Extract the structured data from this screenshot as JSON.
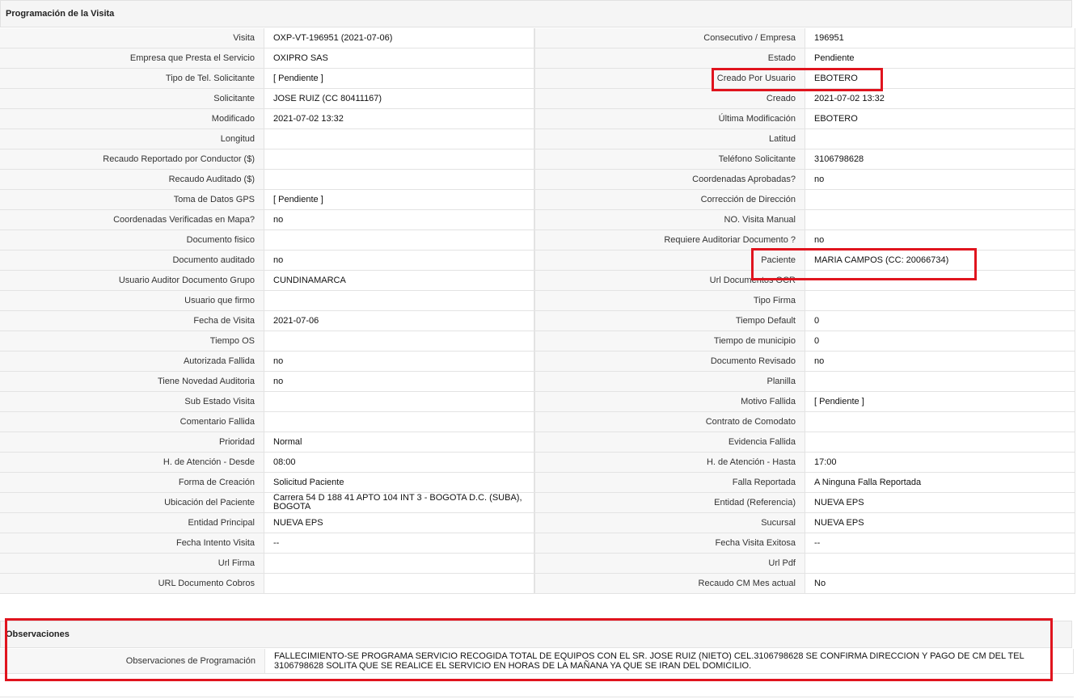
{
  "section_title": "Programación de la Visita",
  "rows": [
    [
      {
        "label": "Visita",
        "value": "OXP-VT-196951 (2021-07-06)"
      },
      {
        "label": "Consecutivo / Empresa",
        "value": "196951"
      }
    ],
    [
      {
        "label": "Empresa que Presta el Servicio",
        "value": "OXIPRO SAS"
      },
      {
        "label": "Estado",
        "value": "Pendiente"
      }
    ],
    [
      {
        "label": "Tipo de Tel. Solicitante",
        "value": "[ Pendiente ]"
      },
      {
        "label": "Creado Por Usuario",
        "value": "EBOTERO"
      }
    ],
    [
      {
        "label": "Solicitante",
        "value": "JOSE RUIZ (CC 80411167)"
      },
      {
        "label": "Creado",
        "value": "2021-07-02 13:32"
      }
    ],
    [
      {
        "label": "Modificado",
        "value": "2021-07-02 13:32"
      },
      {
        "label": "Última Modificación",
        "value": " EBOTERO"
      }
    ],
    [
      {
        "label": "Longitud",
        "value": ""
      },
      {
        "label": "Latitud",
        "value": ""
      }
    ],
    [
      {
        "label": "Recaudo Reportado por Conductor ($)",
        "value": ""
      },
      {
        "label": "Teléfono Solicitante",
        "value": "3106798628"
      }
    ],
    [
      {
        "label": "Recaudo Auditado ($)",
        "value": ""
      },
      {
        "label": "Coordenadas Aprobadas?",
        "value": " no"
      }
    ],
    [
      {
        "label": "Toma de Datos GPS",
        "value": "[ Pendiente ]"
      },
      {
        "label": "Corrección de Dirección",
        "value": ""
      }
    ],
    [
      {
        "label": "Coordenadas Verificadas en Mapa?",
        "value": " no"
      },
      {
        "label": "NO. Visita Manual",
        "value": ""
      }
    ],
    [
      {
        "label": "Documento fisico",
        "value": ""
      },
      {
        "label": "Requiere Auditoriar Documento ?",
        "value": " no"
      }
    ],
    [
      {
        "label": "Documento auditado",
        "value": " no"
      },
      {
        "label": "Paciente",
        "value": "MARIA CAMPOS (CC: 20066734)"
      }
    ],
    [
      {
        "label": "Usuario Auditor Documento Grupo",
        "value": "CUNDINAMARCA"
      },
      {
        "label": "Url Documentos OCR",
        "value": ""
      }
    ],
    [
      {
        "label": "Usuario que firmo",
        "value": ""
      },
      {
        "label": "Tipo Firma",
        "value": ""
      }
    ],
    [
      {
        "label": "Fecha de Visita",
        "value": " 2021-07-06"
      },
      {
        "label": "Tiempo Default",
        "value": "0"
      }
    ],
    [
      {
        "label": "Tiempo OS",
        "value": ""
      },
      {
        "label": "Tiempo de municipio",
        "value": "0"
      }
    ],
    [
      {
        "label": "Autorizada Fallida",
        "value": " no"
      },
      {
        "label": "Documento Revisado",
        "value": " no"
      }
    ],
    [
      {
        "label": "Tiene Novedad Auditoria",
        "value": " no"
      },
      {
        "label": "Planilla",
        "value": ""
      }
    ],
    [
      {
        "label": "Sub Estado Visita",
        "value": ""
      },
      {
        "label": "Motivo Fallida",
        "value": "[ Pendiente ]"
      }
    ],
    [
      {
        "label": "Comentario Fallida",
        "value": ""
      },
      {
        "label": "Contrato de Comodato",
        "value": ""
      }
    ],
    [
      {
        "label": "Prioridad",
        "value": "Normal"
      },
      {
        "label": "Evidencia Fallida",
        "value": ""
      }
    ],
    [
      {
        "label": "H. de Atención - Desde",
        "value": "08:00"
      },
      {
        "label": "H. de Atención - Hasta",
        "value": "17:00"
      }
    ],
    [
      {
        "label": "Forma de Creación",
        "value": "Solicitud Paciente"
      },
      {
        "label": "Falla Reportada",
        "value": "A Ninguna Falla Reportada"
      }
    ],
    [
      {
        "label": "Ubicación del Paciente",
        "value": "Carrera 54 D 188 41 APTO 104 INT 3 - BOGOTA D.C. (SUBA), BOGOTA"
      },
      {
        "label": "Entidad (Referencia)",
        "value": "NUEVA EPS"
      }
    ],
    [
      {
        "label": "Entidad Principal",
        "value": "NUEVA EPS"
      },
      {
        "label": "Sucursal",
        "value": "NUEVA EPS"
      }
    ],
    [
      {
        "label": "Fecha Intento Visita",
        "value": " --"
      },
      {
        "label": "Fecha Visita Exitosa",
        "value": " --"
      }
    ],
    [
      {
        "label": "Url Firma",
        "value": ""
      },
      {
        "label": "Url Pdf",
        "value": ""
      }
    ],
    [
      {
        "label": "URL Documento Cobros",
        "value": ""
      },
      {
        "label": "Recaudo CM Mes actual",
        "value": "No"
      }
    ]
  ],
  "observations": {
    "title": "Observaciones",
    "label": "Observaciones de Programación",
    "value": "  FALLECIMIENTO-SE PROGRAMA SERVICIO RECOGIDA TOTAL DE EQUIPOS CON EL SR. JOSE RUIZ (NIETO) CEL.3106798628 SE CONFIRMA DIRECCION Y PAGO DE CM DEL TEL 3106798628 SOLITA QUE SE REALICE EL SERVICIO EN HORAS DE LA MAÑANA YA QUE SE IRAN DEL DOMICILIO."
  },
  "highlight_color": "#e0141e"
}
